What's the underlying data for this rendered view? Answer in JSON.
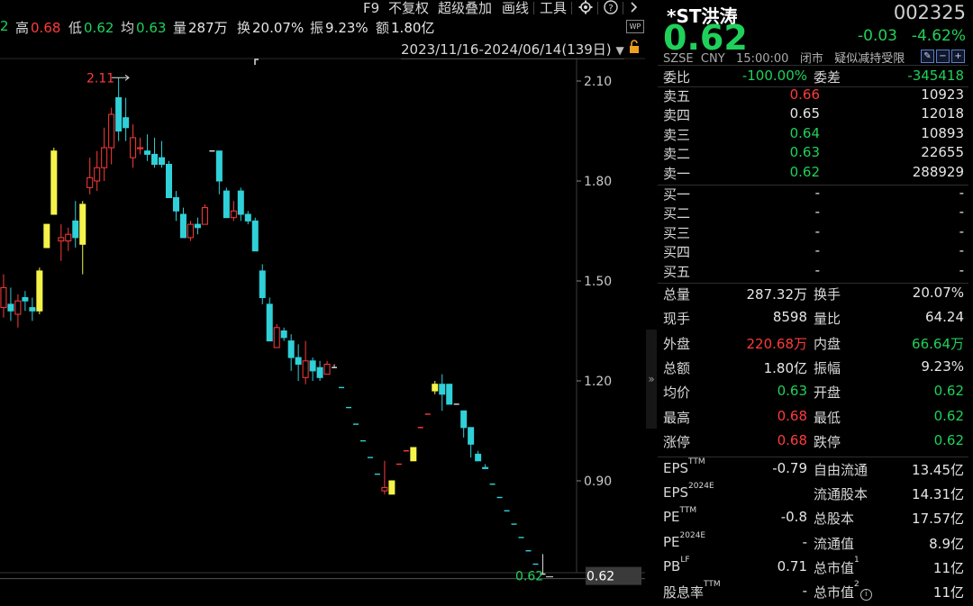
{
  "toolbar": {
    "stats": [
      {
        "label": "2",
        "value": "",
        "value_color": "green"
      },
      {
        "label": "高",
        "value": "0.68",
        "value_color": "red"
      },
      {
        "label": "低",
        "value": "0.62",
        "value_color": "green"
      },
      {
        "label": "均",
        "value": "0.63",
        "value_color": "green"
      },
      {
        "label": "量",
        "value": "287万",
        "value_color": "white"
      },
      {
        "label": "换",
        "value": "20.07%",
        "value_color": "white"
      },
      {
        "label": "振",
        "value": "9.23%",
        "value_color": "white"
      },
      {
        "label": "额",
        "value": "1.80亿",
        "value_color": "white"
      }
    ],
    "buttons": [
      "F9",
      "不复权",
      "超级叠加",
      "画线",
      "工具"
    ],
    "icons": [
      "gear-icon",
      "help-icon",
      "chevron-right-icon",
      "wp-icon"
    ],
    "wp_label": "WP",
    "date_range": "2023/11/16-2024/06/14(139日)",
    "date_dropdown_icon": "triangle-down-icon",
    "lock_icon": "lock-icon"
  },
  "chart_data": {
    "type": "candlestick",
    "y_ticks": [
      "2.10",
      "1.80",
      "1.50",
      "1.20",
      "0.90"
    ],
    "y_tick_values": [
      2.1,
      1.8,
      1.5,
      1.2,
      0.9
    ],
    "ylim": [
      0.62,
      2.2
    ],
    "max_marker": "2.11",
    "last_price_label": "0.62",
    "last_price_box": "0.62",
    "colors": {
      "up": "#ff3b3b",
      "down": "#30d0d8",
      "limit_up": "#f5f34a",
      "limit_down": "#30d0d8"
    },
    "candles": [
      {
        "o": 1.44,
        "h": 1.47,
        "l": 1.36,
        "c": 1.43,
        "t": "d"
      },
      {
        "o": 1.4,
        "h": 1.49,
        "l": 1.37,
        "c": 1.46,
        "t": "u"
      },
      {
        "o": 1.42,
        "h": 1.52,
        "l": 1.39,
        "c": 1.48,
        "t": "u"
      },
      {
        "o": 1.43,
        "h": 1.48,
        "l": 1.38,
        "c": 1.41,
        "t": "d"
      },
      {
        "o": 1.4,
        "h": 1.46,
        "l": 1.36,
        "c": 1.44,
        "t": "u"
      },
      {
        "o": 1.45,
        "h": 1.47,
        "l": 1.41,
        "c": 1.44,
        "t": "d"
      },
      {
        "o": 1.42,
        "h": 1.45,
        "l": 1.38,
        "c": 1.41,
        "t": "d"
      },
      {
        "o": 1.41,
        "h": 1.54,
        "l": 1.4,
        "c": 1.53,
        "t": "L"
      },
      {
        "o": 1.6,
        "h": 1.67,
        "l": 1.6,
        "c": 1.67,
        "t": "L"
      },
      {
        "o": 1.7,
        "h": 1.9,
        "l": 1.7,
        "c": 1.89,
        "t": "L"
      },
      {
        "o": 1.63,
        "h": 1.67,
        "l": 1.56,
        "c": 1.62,
        "t": "u"
      },
      {
        "o": 1.62,
        "h": 1.66,
        "l": 1.59,
        "c": 1.64,
        "t": "u"
      },
      {
        "o": 1.68,
        "h": 1.74,
        "l": 1.6,
        "c": 1.63,
        "t": "d"
      },
      {
        "o": 1.61,
        "h": 1.74,
        "l": 1.52,
        "c": 1.73,
        "t": "L"
      },
      {
        "o": 1.78,
        "h": 1.87,
        "l": 1.76,
        "c": 1.81,
        "t": "u"
      },
      {
        "o": 1.8,
        "h": 1.89,
        "l": 1.77,
        "c": 1.84,
        "t": "u"
      },
      {
        "o": 1.84,
        "h": 1.96,
        "l": 1.8,
        "c": 1.9,
        "t": "u"
      },
      {
        "o": 1.9,
        "h": 2.02,
        "l": 1.85,
        "c": 2.0,
        "t": "u"
      },
      {
        "o": 2.05,
        "h": 2.11,
        "l": 1.92,
        "c": 1.95,
        "t": "d"
      },
      {
        "o": 1.99,
        "h": 2.05,
        "l": 1.92,
        "c": 1.96,
        "t": "d"
      },
      {
        "o": 1.87,
        "h": 1.97,
        "l": 1.84,
        "c": 1.93,
        "t": "u"
      },
      {
        "o": 1.9,
        "h": 1.93,
        "l": 1.88,
        "c": 1.9,
        "t": "u"
      },
      {
        "o": 1.89,
        "h": 1.94,
        "l": 1.86,
        "c": 1.88,
        "t": "d"
      },
      {
        "o": 1.88,
        "h": 1.93,
        "l": 1.84,
        "c": 1.85,
        "t": "d"
      },
      {
        "o": 1.87,
        "h": 1.92,
        "l": 1.84,
        "c": 1.85,
        "t": "d"
      },
      {
        "o": 1.85,
        "h": 1.86,
        "l": 1.75,
        "c": 1.75,
        "t": "d"
      },
      {
        "o": 1.75,
        "h": 1.77,
        "l": 1.68,
        "c": 1.71,
        "t": "d"
      },
      {
        "o": 1.7,
        "h": 1.72,
        "l": 1.63,
        "c": 1.63,
        "t": "d"
      },
      {
        "o": 1.63,
        "h": 1.68,
        "l": 1.62,
        "c": 1.67,
        "t": "u"
      },
      {
        "o": 1.67,
        "h": 1.69,
        "l": 1.64,
        "c": 1.66,
        "t": "d"
      },
      {
        "o": 1.67,
        "h": 1.73,
        "l": 1.67,
        "c": 1.72,
        "t": "u"
      },
      {
        "o": 1.89,
        "h": 1.89,
        "l": 1.89,
        "c": 1.89,
        "t": "flat"
      },
      {
        "o": 1.89,
        "h": 1.89,
        "l": 1.76,
        "c": 1.8,
        "t": "d"
      },
      {
        "o": 1.77,
        "h": 1.78,
        "l": 1.69,
        "c": 1.69,
        "t": "d"
      },
      {
        "o": 1.71,
        "h": 1.74,
        "l": 1.68,
        "c": 1.69,
        "t": "u"
      },
      {
        "o": 1.77,
        "h": 1.78,
        "l": 1.68,
        "c": 1.7,
        "t": "d"
      },
      {
        "o": 1.7,
        "h": 1.71,
        "l": 1.67,
        "c": 1.68,
        "t": "d"
      },
      {
        "o": 1.68,
        "h": 1.69,
        "l": 1.59,
        "c": 1.59,
        "t": "d"
      },
      {
        "o": 1.53,
        "h": 1.55,
        "l": 1.43,
        "c": 1.45,
        "t": "d"
      },
      {
        "o": 1.43,
        "h": 1.45,
        "l": 1.32,
        "c": 1.32,
        "t": "d"
      },
      {
        "o": 1.3,
        "h": 1.37,
        "l": 1.3,
        "c": 1.36,
        "t": "u"
      },
      {
        "o": 1.35,
        "h": 1.36,
        "l": 1.32,
        "c": 1.33,
        "t": "d"
      },
      {
        "o": 1.32,
        "h": 1.34,
        "l": 1.23,
        "c": 1.27,
        "t": "d"
      },
      {
        "o": 1.27,
        "h": 1.31,
        "l": 1.2,
        "c": 1.25,
        "t": "d"
      },
      {
        "o": 1.21,
        "h": 1.32,
        "l": 1.19,
        "c": 1.26,
        "t": "u"
      },
      {
        "o": 1.26,
        "h": 1.27,
        "l": 1.2,
        "c": 1.23,
        "t": "d"
      },
      {
        "o": 1.24,
        "h": 1.26,
        "l": 1.2,
        "c": 1.21,
        "t": "d"
      },
      {
        "o": 1.22,
        "h": 1.26,
        "l": 1.22,
        "c": 1.25,
        "t": "u"
      },
      {
        "o": 1.24,
        "h": 1.25,
        "l": 1.24,
        "c": 1.24,
        "t": "flat"
      },
      {
        "o": 1.18,
        "h": 1.18,
        "l": 1.18,
        "c": 1.18,
        "t": "limit_down_dash"
      },
      {
        "o": 1.12,
        "h": 1.12,
        "l": 1.12,
        "c": 1.12,
        "t": "limit_down_dash"
      },
      {
        "o": 1.07,
        "h": 1.07,
        "l": 1.07,
        "c": 1.07,
        "t": "limit_down_dash"
      },
      {
        "o": 1.02,
        "h": 1.02,
        "l": 1.02,
        "c": 1.02,
        "t": "limit_down_dash"
      },
      {
        "o": 0.97,
        "h": 0.97,
        "l": 0.97,
        "c": 0.97,
        "t": "limit_down_dash"
      },
      {
        "o": 0.92,
        "h": 0.92,
        "l": 0.92,
        "c": 0.92,
        "t": "limit_down_dash"
      },
      {
        "o": 0.88,
        "h": 0.96,
        "l": 0.86,
        "c": 0.87,
        "t": "u"
      },
      {
        "o": 0.86,
        "h": 0.9,
        "l": 0.86,
        "c": 0.9,
        "t": "L"
      },
      {
        "o": 0.95,
        "h": 0.95,
        "l": 0.95,
        "c": 0.95,
        "t": "limit_up_dash"
      },
      {
        "o": 0.99,
        "h": 0.99,
        "l": 0.99,
        "c": 0.99,
        "t": "limit_up_dash"
      },
      {
        "o": 0.96,
        "h": 1.0,
        "l": 0.96,
        "c": 1.0,
        "t": "L"
      },
      {
        "o": 1.06,
        "h": 1.06,
        "l": 1.06,
        "c": 1.06,
        "t": "limit_up_dash"
      },
      {
        "o": 1.1,
        "h": 1.1,
        "l": 1.1,
        "c": 1.1,
        "t": "limit_up_dash"
      },
      {
        "o": 1.17,
        "h": 1.2,
        "l": 1.16,
        "c": 1.19,
        "t": "L"
      },
      {
        "o": 1.19,
        "h": 1.22,
        "l": 1.11,
        "c": 1.16,
        "t": "d"
      },
      {
        "o": 1.19,
        "h": 1.19,
        "l": 1.13,
        "c": 1.13,
        "t": "d"
      },
      {
        "o": 1.13,
        "h": 1.13,
        "l": 1.13,
        "c": 1.13,
        "t": "flat"
      },
      {
        "o": 1.11,
        "h": 1.11,
        "l": 1.03,
        "c": 1.06,
        "t": "d"
      },
      {
        "o": 1.06,
        "h": 1.06,
        "l": 0.97,
        "c": 1.01,
        "t": "d"
      },
      {
        "o": 0.98,
        "h": 0.99,
        "l": 0.96,
        "c": 0.96,
        "t": "d"
      },
      {
        "o": 0.94,
        "h": 0.95,
        "l": 0.94,
        "c": 0.94,
        "t": "d"
      },
      {
        "o": 0.89,
        "h": 0.89,
        "l": 0.89,
        "c": 0.89,
        "t": "limit_down_dash"
      },
      {
        "o": 0.85,
        "h": 0.85,
        "l": 0.85,
        "c": 0.85,
        "t": "limit_down_dash"
      },
      {
        "o": 0.81,
        "h": 0.81,
        "l": 0.81,
        "c": 0.81,
        "t": "limit_down_dash"
      },
      {
        "o": 0.77,
        "h": 0.77,
        "l": 0.77,
        "c": 0.77,
        "t": "limit_down_dash"
      },
      {
        "o": 0.73,
        "h": 0.73,
        "l": 0.73,
        "c": 0.73,
        "t": "limit_down_dash"
      },
      {
        "o": 0.69,
        "h": 0.69,
        "l": 0.69,
        "c": 0.69,
        "t": "limit_down_dash"
      },
      {
        "o": 0.65,
        "h": 0.65,
        "l": 0.65,
        "c": 0.65,
        "t": "limit_down_dash"
      },
      {
        "o": 0.62,
        "h": 0.68,
        "l": 0.62,
        "c": 0.62,
        "t": "flat"
      }
    ]
  },
  "quote": {
    "name": "*ST洪涛",
    "code": "002325",
    "price": "0.62",
    "change": "-0.03",
    "change_pct": "-4.62%",
    "exchange": "SZSE",
    "currency": "CNY",
    "time": "15:00:00",
    "status": "闭市",
    "tag": "疑似减持受限"
  },
  "weibi": {
    "label1": "委比",
    "value1": "-100.00%",
    "label2": "委差",
    "value2": "-345418"
  },
  "asks": [
    {
      "label": "卖五",
      "price": "0.66",
      "vol": "10923",
      "color": "red"
    },
    {
      "label": "卖四",
      "price": "0.65",
      "vol": "12018",
      "color": "white"
    },
    {
      "label": "卖三",
      "price": "0.64",
      "vol": "10893",
      "color": "green"
    },
    {
      "label": "卖二",
      "price": "0.63",
      "vol": "22655",
      "color": "green"
    },
    {
      "label": "卖一",
      "price": "0.62",
      "vol": "288929",
      "color": "green"
    }
  ],
  "bids": [
    {
      "label": "买一",
      "price": "-",
      "vol": "-"
    },
    {
      "label": "买二",
      "price": "-",
      "vol": "-"
    },
    {
      "label": "买三",
      "price": "-",
      "vol": "-"
    },
    {
      "label": "买四",
      "price": "-",
      "vol": "-"
    },
    {
      "label": "买五",
      "price": "-",
      "vol": "-"
    }
  ],
  "stats1": [
    {
      "l1": "总量",
      "v1": "287.32万",
      "c1": "white",
      "l2": "换手",
      "v2": "20.07%",
      "c2": "white"
    },
    {
      "l1": "现手",
      "v1": "8598",
      "c1": "white",
      "l2": "量比",
      "v2": "64.24",
      "c2": "white"
    },
    {
      "l1": "外盘",
      "v1": "220.68万",
      "c1": "red",
      "l2": "内盘",
      "v2": "66.64万",
      "c2": "green"
    },
    {
      "l1": "总额",
      "v1": "1.80亿",
      "c1": "white",
      "l2": "振幅",
      "v2": "9.23%",
      "c2": "white"
    },
    {
      "l1": "均价",
      "v1": "0.63",
      "c1": "green",
      "l2": "开盘",
      "v2": "0.62",
      "c2": "green"
    },
    {
      "l1": "最高",
      "v1": "0.68",
      "c1": "red",
      "l2": "最低",
      "v2": "0.62",
      "c2": "green"
    },
    {
      "l1": "涨停",
      "v1": "0.68",
      "c1": "red",
      "l2": "跌停",
      "v2": "0.62",
      "c2": "green"
    }
  ],
  "stats2": [
    {
      "l1": "EPS",
      "s1": "TTM",
      "v1": "-0.79",
      "l2": "自由流通",
      "s2": "",
      "v2": "13.45亿"
    },
    {
      "l1": "EPS",
      "s1": "2024E",
      "v1": "",
      "l2": "流通股本",
      "s2": "",
      "v2": "14.31亿"
    },
    {
      "l1": "PE",
      "s1": "TTM",
      "v1": "-0.8",
      "l2": "总股本",
      "s2": "",
      "v2": "17.57亿"
    },
    {
      "l1": "PE",
      "s1": "2024E",
      "v1": "-",
      "l2": "流通值",
      "s2": "",
      "v2": "8.9亿"
    },
    {
      "l1": "PB",
      "s1": "LF",
      "v1": "0.71",
      "l2": "总市值",
      "s2": "1",
      "v2": "11亿"
    },
    {
      "l1": "股息率",
      "s1": "TTM",
      "v1": "-",
      "l2": "总市值",
      "s2": "2",
      "v2": "11亿"
    }
  ]
}
